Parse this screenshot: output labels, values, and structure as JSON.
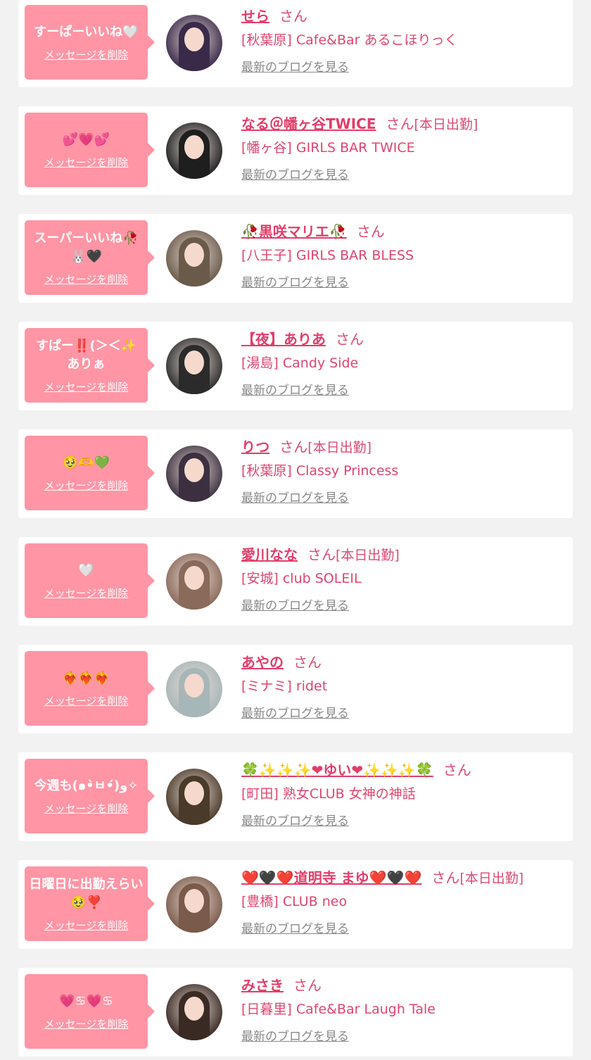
{
  "delete_label": "メッセージを削除",
  "san_label": "さん",
  "blog_label": "最新のブログを見る",
  "colors": {
    "bubble": "#ff95a5",
    "name": "#e23d6a",
    "card": "#ffffff",
    "background": "#f2f2f2"
  },
  "entries": [
    {
      "message": "すーぱーいいね🤍",
      "name": "せら",
      "status": "",
      "shop": "[秋葉原] Cafe&Bar あるこほりっく",
      "avatar_color": "#3a2a4a"
    },
    {
      "message": "💕💗💕",
      "name": "なる＠幡ヶ谷TWICE",
      "status": "[本日出勤]",
      "shop": "[幡ヶ谷] GIRLS BAR TWICE",
      "avatar_color": "#1e1e1e"
    },
    {
      "message": "スーパーいいね🥀🐰🖤",
      "name": "🥀黒咲マリエ🥀",
      "status": "",
      "shop": "[八王子] GIRLS BAR BLESS",
      "avatar_color": "#6a5a4a"
    },
    {
      "message": "すぱー‼️(＞＜✨ ありぁ",
      "name": "【夜】ありあ",
      "status": "",
      "shop": "[湯島] Candy Side",
      "avatar_color": "#2b2b2b"
    },
    {
      "message": "🥹🫶💚",
      "name": "りつ",
      "status": "[本日出勤]",
      "shop": "[秋葉原] Classy Princess",
      "avatar_color": "#3c3040"
    },
    {
      "message": "🤍",
      "name": "愛川なな",
      "status": "[本日出勤]",
      "shop": "[安城] club SOLEIL",
      "avatar_color": "#8a6a5a"
    },
    {
      "message": "❤️‍🔥❤️‍🔥❤️‍🔥",
      "name": "あやの",
      "status": "",
      "shop": "[ミナミ] ridet",
      "avatar_color": "#a7b6b8"
    },
    {
      "message": "今週も(๑•̀ㅂ•́)و✧",
      "name": "🍀✨✨✨❤ゆい❤✨✨✨🍀",
      "status": "",
      "shop": "[町田] 熟女CLUB 女神の神話",
      "avatar_color": "#4a3a2a"
    },
    {
      "message": "日曜日に出勤えらい🥹❣️",
      "name": "❤️🖤❤️道明寺 まゆ❤️🖤❤️",
      "status": "[本日出勤]",
      "shop": "[豊橋] CLUB neo",
      "avatar_color": "#7a5a4a"
    },
    {
      "message": "💗♋💗♋",
      "name": "みさき",
      "status": "",
      "shop": "[日暮里] Cafe&Bar Laugh Tale",
      "avatar_color": "#3a2a24"
    }
  ]
}
